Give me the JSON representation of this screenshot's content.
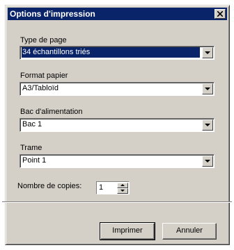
{
  "window": {
    "title": "Options d'impression"
  },
  "fields": {
    "page_type": {
      "label": "Type de page",
      "value": "34 échantillons triés"
    },
    "paper_format": {
      "label": "Format papier",
      "value": "A3/Tabloïd"
    },
    "feed_tray": {
      "label": "Bac d'alimentation",
      "value": "Bac 1"
    },
    "screen": {
      "label": "Trame",
      "value": "Point 1"
    },
    "copies": {
      "label": "Nombre de copies:",
      "value": "1"
    }
  },
  "buttons": {
    "print": "Imprimer",
    "cancel": "Annuler"
  },
  "icons": {
    "close": "close-icon",
    "dropdown": "chevron-down-icon",
    "spin_up": "arrow-up-icon",
    "spin_down": "arrow-down-icon"
  },
  "colors": {
    "titlebar": "#0a246a",
    "face": "#d4d0c8",
    "selection": "#0a246a"
  }
}
